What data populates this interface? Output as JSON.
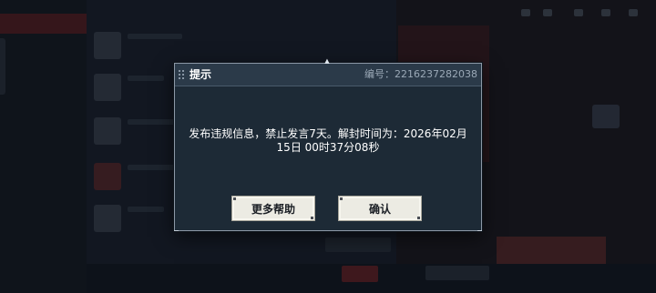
{
  "dialog": {
    "title": "提示",
    "id_label": "编号：2216237282038",
    "message_line1": "发布违规信息，禁止发言7天。解封时间为：2026年02月",
    "message_line2": "15日 00时37分08秒",
    "help_button": "更多帮助",
    "confirm_button": "确认"
  },
  "colors": {
    "dialog_bg": "#1d2a36",
    "header_bg": "#2b3a49",
    "button_bg": "#ecebe3",
    "accent_red": "#5a1f25"
  }
}
